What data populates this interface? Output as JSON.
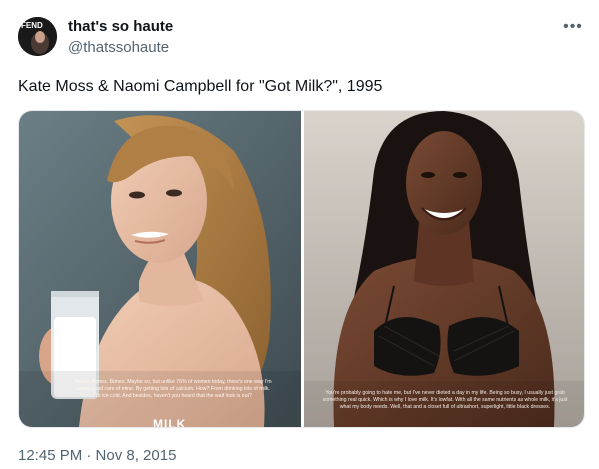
{
  "author": {
    "display_name": "that's so haute",
    "handle": "@thatssohaute",
    "avatar_text": "FEND"
  },
  "more_icon": "more-horizontal-icon",
  "tweet": {
    "text": "Kate Moss & Naomi Campbell for \"Got Milk?\", 1995",
    "timestamp": "12:45 PM · Nov 8, 2015"
  },
  "media": {
    "left_photo": {
      "ad_copy": "Bones. Bones. Bones. Maybe so, but unlike 75% of women today, there's one way I'm taking good care of mine. By getting lots of calcium. How? From drinking lots of milk. It's ice cold. And besides, haven't you heard that the waif look is out?",
      "brand_mark": "MILK"
    },
    "right_photo": {
      "ad_copy": "You're probably going to hate me, but I've never dieted a day in my life. Being so busy, I usually just grab something real quick. Which is why I love milk. It's lowfat. With all the same nutrients as whole milk, it's just what my body needs. Well, that and a closet full of ultrashort, superlight, little black dresses."
    }
  },
  "colors": {
    "text_primary": "#0f1419",
    "text_secondary": "#536471",
    "border": "#e6e8eb"
  }
}
